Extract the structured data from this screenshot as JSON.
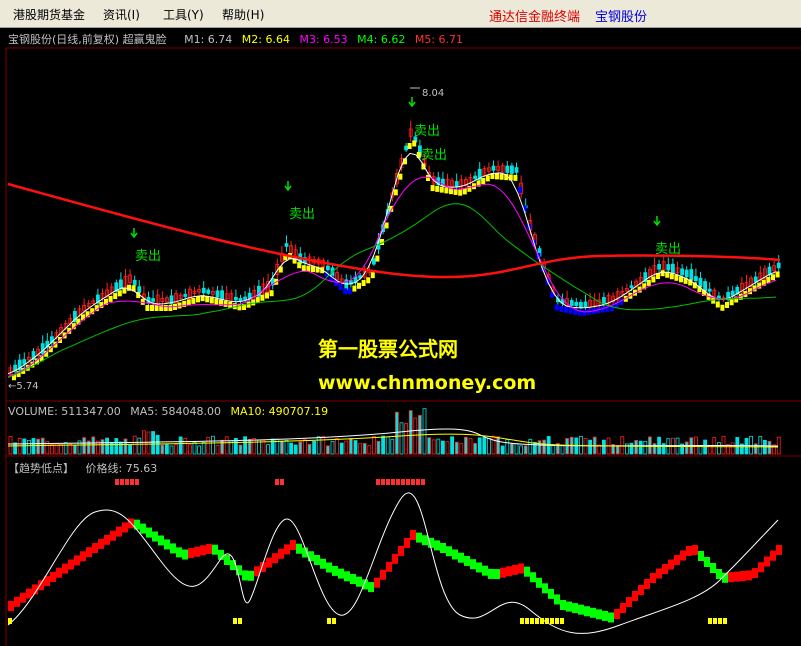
{
  "menu": {
    "items": [
      "港股期货基金",
      "资讯(I)",
      "工具(Y)",
      "帮助(H)"
    ],
    "right_red": "通达信金融终端",
    "right_blue": "宝钢股份"
  },
  "header": {
    "stock": "宝钢股份(日线,前复权) 超赢鬼脸",
    "ma": [
      {
        "label": "M1: 6.74",
        "color": "#c0c0c0"
      },
      {
        "label": "M2: 6.64",
        "color": "#ffff00"
      },
      {
        "label": "M3: 6.53",
        "color": "#ff00ff"
      },
      {
        "label": "M4: 6.62",
        "color": "#00ff00"
      },
      {
        "label": "M5: 6.71",
        "color": "#ff3030"
      }
    ]
  },
  "price_labels": {
    "high": "8.04",
    "low": "←5.74"
  },
  "sell_signals": [
    "卖出",
    "卖出",
    "卖出",
    "卖出",
    "卖出"
  ],
  "watermark": {
    "line1": "第一股票公式网",
    "line2": "www.chnmoney.com"
  },
  "volume": {
    "label": "VOLUME: 511347.00",
    "ma5": "MA5: 584048.00",
    "ma10": "MA10: 490707.19"
  },
  "indicator": {
    "title": "【趋势低点】",
    "value": "价格线: 75.63"
  },
  "colors": {
    "up": "#ff2020",
    "down": "#00e0e0",
    "yellow": "#ffff00",
    "blue": "#0000ff",
    "green": "#00ff00",
    "red": "#ff0000",
    "axis": "#800000"
  }
}
